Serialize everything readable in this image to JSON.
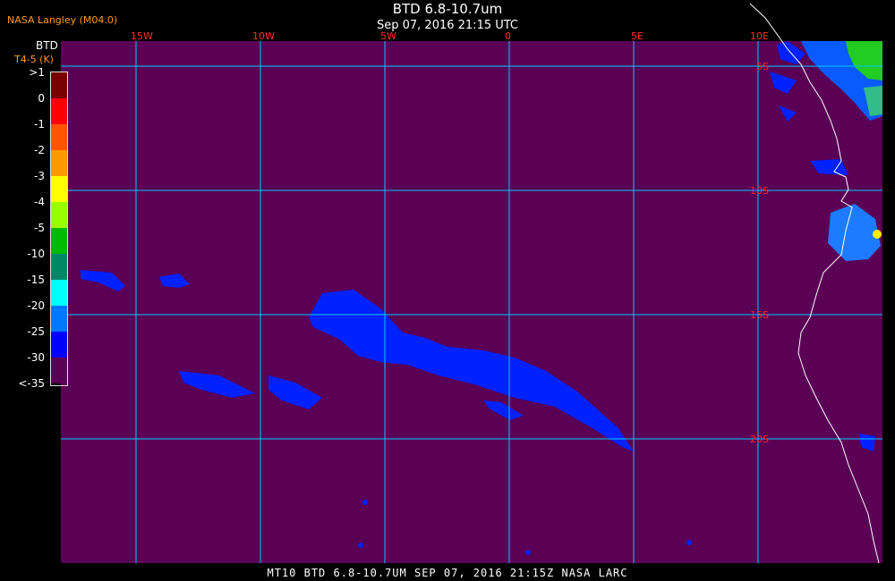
{
  "header": {
    "source": "NASA Langley (M04.0)",
    "title": "BTD 6.8-10.7um",
    "timestamp": "Sep 07, 2016 21:15 UTC"
  },
  "legend": {
    "title": "BTD",
    "subtitle": "T4-5 (K)",
    "labels": [
      ">1",
      "0",
      "-1",
      "-2",
      "-3",
      "-4",
      "-5",
      "-10",
      "-15",
      "-20",
      "-25",
      "-30",
      "<-35"
    ],
    "colors": [
      "#7a0000",
      "#ff0000",
      "#ff5500",
      "#ff9900",
      "#ffff00",
      "#99ff00",
      "#00bb00",
      "#008866",
      "#00ffff",
      "#0077ff",
      "#0000ff",
      "#5a0055"
    ]
  },
  "map": {
    "background_color": "#5a0055",
    "grid_color": "#00ccff",
    "coast_color": "#ffffff",
    "longitude_labels": [
      "15W",
      "10W",
      "5W",
      "0",
      "5E",
      "10E"
    ],
    "latitude_labels": [
      "5S",
      "10S",
      "15S",
      "20S"
    ]
  },
  "footer": {
    "caption": "MT10  BTD 6.8-10.7UM   SEP 07, 2016 21:15Z   NASA LARC"
  }
}
